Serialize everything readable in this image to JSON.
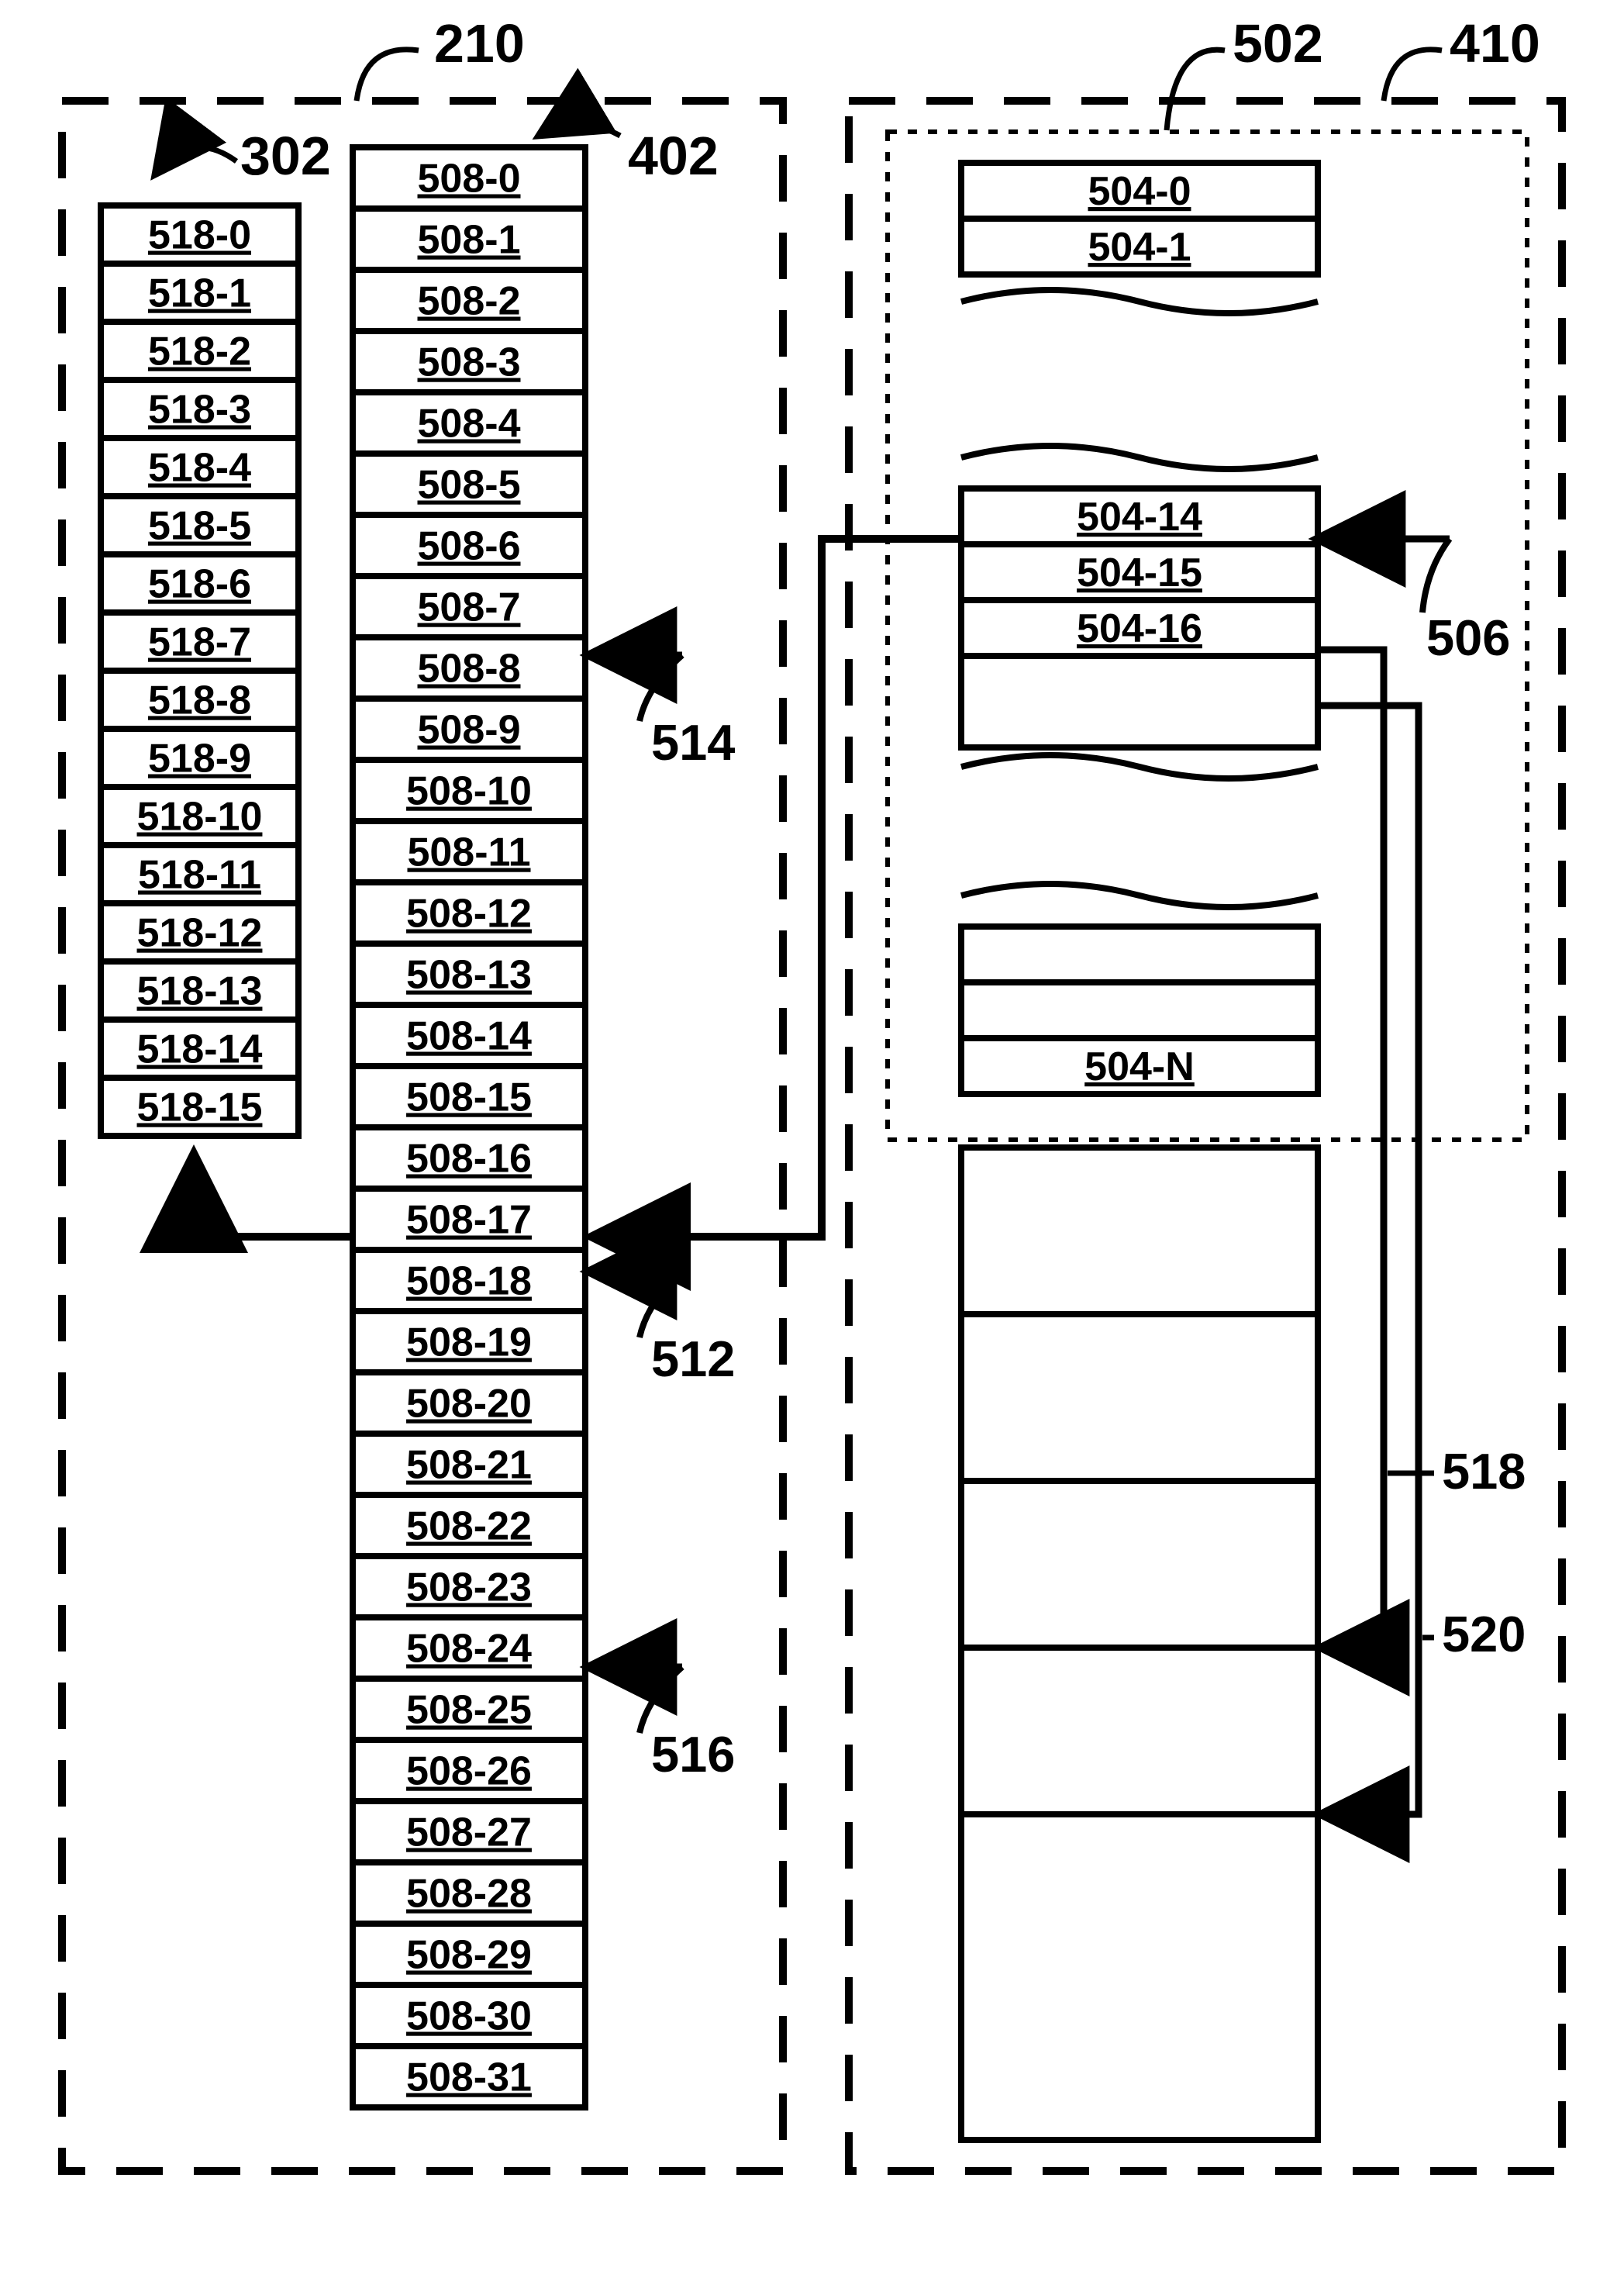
{
  "labels": {
    "box210": "210",
    "box410": "410",
    "col302": "302",
    "col402": "402",
    "col502": "502",
    "ref506": "506",
    "ref512": "512",
    "ref514": "514",
    "ref516": "516",
    "ref518": "518",
    "ref520": "520"
  },
  "col518": [
    "518-0",
    "518-1",
    "518-2",
    "518-3",
    "518-4",
    "518-5",
    "518-6",
    "518-7",
    "518-8",
    "518-9",
    "518-10",
    "518-11",
    "518-12",
    "518-13",
    "518-14",
    "518-15"
  ],
  "col508": [
    "508-0",
    "508-1",
    "508-2",
    "508-3",
    "508-4",
    "508-5",
    "508-6",
    "508-7",
    "508-8",
    "508-9",
    "508-10",
    "508-11",
    "508-12",
    "508-13",
    "508-14",
    "508-15",
    "508-16",
    "508-17",
    "508-18",
    "508-19",
    "508-20",
    "508-21",
    "508-22",
    "508-23",
    "508-24",
    "508-25",
    "508-26",
    "508-27",
    "508-28",
    "508-29",
    "508-30",
    "508-31"
  ],
  "col504_top": [
    "504-0",
    "504-1"
  ],
  "col504_mid": [
    "504-14",
    "504-15",
    "504-16"
  ],
  "col504_last": "504-N"
}
